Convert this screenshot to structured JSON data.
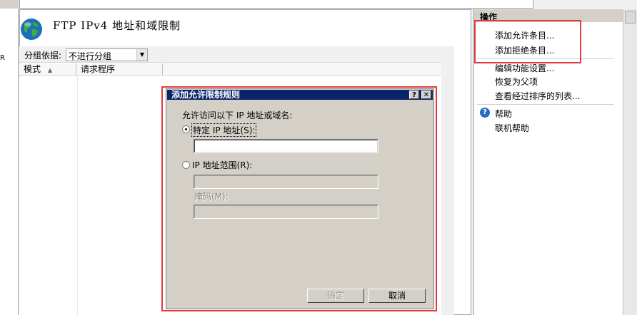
{
  "left_strip": {
    "fragment": "R"
  },
  "header": {
    "title": "FTP IPv4 地址和域限制"
  },
  "group_bar": {
    "label": "分组依据:",
    "selected": "不进行分组"
  },
  "columns": {
    "mode": "模式",
    "requester": "请求程序"
  },
  "actions": {
    "header": "操作",
    "add_allow": "添加允许条目...",
    "add_deny": "添加拒绝条目...",
    "edit_settings": "编辑功能设置...",
    "revert_parent": "恢复为父项",
    "view_ordered": "查看经过排序的列表...",
    "help": "帮助",
    "online_help": "联机帮助"
  },
  "dialog": {
    "title": "添加允许限制规则",
    "help_btn": "?",
    "close_btn": "✕",
    "prompt": "允许访问以下 IP 地址或域名:",
    "specific_ip_label": "特定 IP 地址(S):",
    "specific_ip_value": "",
    "ip_range_label": "IP 地址范围(R):",
    "ip_range_value": "",
    "mask_label": "掩码(M):",
    "mask_value": "",
    "ok_label": "确定",
    "cancel_label": "取消"
  },
  "colors": {
    "highlight": "#e23a3a",
    "titlebar": "#0a246a"
  }
}
